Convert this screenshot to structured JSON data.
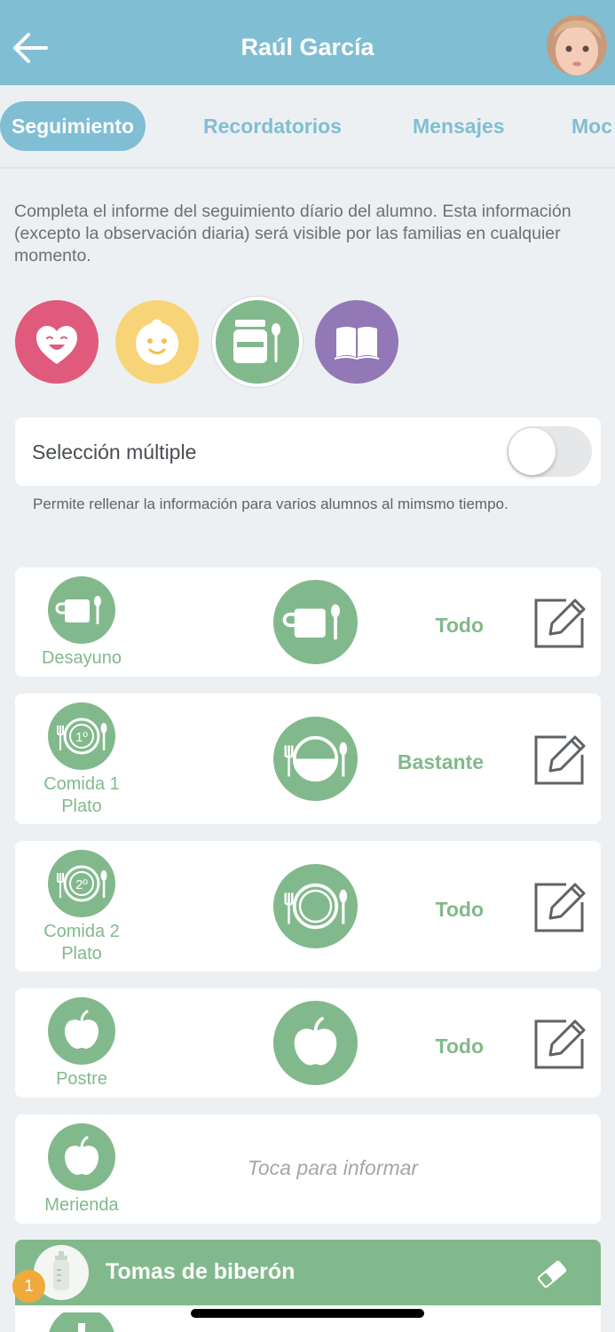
{
  "header": {
    "title": "Raúl García"
  },
  "tabs": [
    {
      "label": "Seguimiento",
      "active": true
    },
    {
      "label": "Recordatorios",
      "active": false
    },
    {
      "label": "Mensajes",
      "active": false
    },
    {
      "label": "Moc",
      "active": false
    }
  ],
  "intro": "Completa el informe del seguimiento díario del alumno. Esta información (excepto la observación diaria) será visible por las familias en cualquier momento.",
  "categories": [
    {
      "icon": "heart-face-icon",
      "color": "#e05a7c"
    },
    {
      "icon": "baby-face-icon",
      "color": "#f8d478"
    },
    {
      "icon": "food-jar-icon",
      "color": "#82b98c",
      "selected": true
    },
    {
      "icon": "book-icon",
      "color": "#9278b6"
    }
  ],
  "multi_select": {
    "label": "Selección múltiple",
    "help": "Permite rellenar la información para varios alumnos al mimsmo tiempo.",
    "enabled": false
  },
  "meals": [
    {
      "name_line1": "Desayuno",
      "name_line2": "",
      "value": "Todo",
      "icon": "cup-spoon-icon",
      "level": 1
    },
    {
      "name_line1": "Comida 1",
      "name_line2": "Plato",
      "value": "Bastante",
      "icon": "plate-first-icon",
      "level": 0.5
    },
    {
      "name_line1": "Comida 2",
      "name_line2": "Plato",
      "value": "Todo",
      "icon": "plate-second-icon",
      "level": 1
    },
    {
      "name_line1": "Postre",
      "name_line2": "",
      "value": "Todo",
      "icon": "apple-icon",
      "level": 1
    },
    {
      "name_line1": "Merienda",
      "name_line2": "",
      "value": "",
      "icon": "apple-icon",
      "tap_message": "Toca para informar"
    }
  ],
  "plate_badges": {
    "first": "1º",
    "second": "2º"
  },
  "bottle": {
    "title": "Tomas de biberón",
    "badge": "1"
  },
  "colors": {
    "header": "#80bed4",
    "green": "#82b98c",
    "pink": "#e05a7c",
    "yellow": "#f8d478",
    "purple": "#9278b6",
    "badge": "#f0a93b"
  }
}
